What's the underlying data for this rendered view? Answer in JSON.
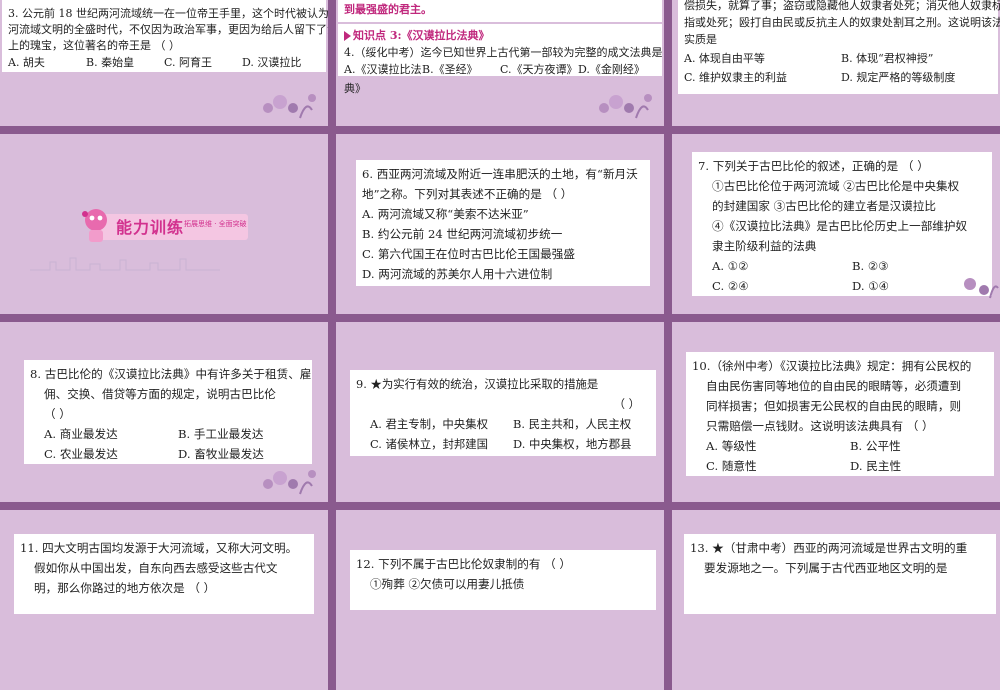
{
  "panels": {
    "p1": {
      "lines": [
        "3. 公元前 18 世纪两河流域统一在一位帝王手里，这个时代被认为是上古两",
        "河流域文明的全盛时代，不仅因为政治军事，更因为给后人留下了法制史",
        "上的瑰宝，这位著名的帝王是                                    （     ）"
      ],
      "options": [
        "A. 胡夫",
        "B. 秦始皇",
        "C. 阿育王",
        "D. 汉谟拉比"
      ]
    },
    "p2": {
      "top_line": "到最强盛的君主。",
      "section": "知识点 3:《汉谟拉比法典》",
      "question": "4.（绥化中考）迄今已知世界上古代第一部较为完整的成文法典是         （     ）",
      "options": [
        "A.《汉谟拉比法典》",
        "B.《圣经》",
        "C.《天方夜谭》",
        "D.《金刚经》"
      ]
    },
    "p3": {
      "lines": [
        "偿损失，就算了事；盗窃或隐藏他人奴隶者处死；消灭他人奴隶标记者断",
        "指或处死；殴打自由民或反抗主人的奴隶处割耳之刑。这说明该法典的",
        "实质是"
      ],
      "options": [
        "A. 体现自由平等",
        "B. 体现“君权神授”",
        "C. 维护奴隶主的利益",
        "D. 规定严格的等级制度"
      ]
    },
    "p4": {
      "banner_title": "能力训练",
      "banner_sub": "拓展思维 · 全面突破"
    },
    "p5": {
      "lines": [
        "6. 西亚两河流域及附近一连串肥沃的土地，有“新月沃",
        "地”之称。下列对其表述不正确的是        （     ）"
      ],
      "options": [
        "A. 两河流域又称“美索不达米亚”",
        "B. 约公元前 24 世纪两河流域初步统一",
        "C. 第六代国王在位时古巴比伦王国最强盛",
        "D. 两河流域的苏美尔人用十六进位制"
      ]
    },
    "p6": {
      "lines": [
        "7. 下列关于古巴比伦的叙述，正确的是       （     ）",
        "①古巴比伦位于两河流域   ②古巴比伦是中央集权",
        "的封建国家   ③古巴比伦的建立者是汉谟拉比",
        "④《汉谟拉比法典》是古巴比伦历史上一部维护奴",
        "隶主阶级利益的法典"
      ],
      "options": [
        "A. ①②",
        "B. ②③",
        "C. ②④",
        "D. ①④"
      ]
    },
    "p7": {
      "lines": [
        "8. 古巴比伦的《汉谟拉比法典》中有许多关于租赁、雇",
        "佣、交换、借贷等方面的规定，说明古巴比伦",
        "                                                         （     ）"
      ],
      "options": [
        "A. 商业最发达",
        "B. 手工业最发达",
        "C. 农业最发达",
        "D. 畜牧业最发达"
      ]
    },
    "p8": {
      "question": "9. ★为实行有效的统治，汉谟拉比采取的措施是",
      "paren": "（     ）",
      "options": [
        "A. 君主专制，中央集权",
        "B. 民主共和，人民主权",
        "C. 诸侯林立，封邦建国",
        "D. 中央集权，地方郡县"
      ]
    },
    "p9": {
      "lines": [
        "10.（徐州中考）《汉谟拉比法典》规定：拥有公民权的",
        "自由民伤害同等地位的自由民的眼睛等，必须遭到",
        "同样损害；但如损害无公民权的自由民的眼睛，则",
        "只需赔偿一点钱财。这说明该法典具有     （     ）"
      ],
      "options": [
        "A. 等级性",
        "B. 公平性",
        "C. 随意性",
        "D. 民主性"
      ]
    },
    "p10": {
      "lines": [
        "11. 四大文明古国均发源于大河流域，又称大河文明。",
        "假如你从中国出发，自东向西去感受这些古代文",
        "明，那么你路过的地方依次是               （     ）"
      ]
    },
    "p11": {
      "lines": [
        "12. 下列不属于古巴比伦奴隶制的有         （     ）",
        "①殉葬                       ②欠债可以用妻儿抵债"
      ]
    },
    "p12": {
      "lines": [
        "13. ★（甘肃中考）西亚的两河流域是世界古文明的重",
        "要发源地之一。下列属于古代西亚地区文明的是"
      ]
    }
  }
}
